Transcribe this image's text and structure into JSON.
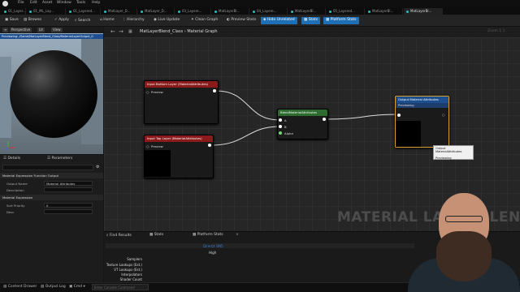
{
  "menu": [
    "File",
    "Edit",
    "Asset",
    "Window",
    "Tools",
    "Help"
  ],
  "tabs": [
    {
      "label": "01_Layer..."
    },
    {
      "label": "01_ML_Lay..."
    },
    {
      "label": "01_Layered..."
    },
    {
      "label": "MatLayer_D..."
    },
    {
      "label": "MatLayer_D..."
    },
    {
      "label": "03_Layere..."
    },
    {
      "label": "MatLayerBl..."
    },
    {
      "label": "04_Layere..."
    },
    {
      "label": "MatLayerBl..."
    },
    {
      "label": "05_Layered..."
    },
    {
      "label": "MatLayerBl..."
    },
    {
      "label": "MatLayerBl..."
    }
  ],
  "toolbar": {
    "save": "Save",
    "browse": "Browse",
    "apply": "Apply",
    "search": "Search",
    "home": "Home",
    "hierarchy": "Hierarchy",
    "live_update": "Live Update",
    "clean_graph": "Clean Graph",
    "preview_state": "Preview State",
    "hide_unrelated": "Hide Unrelated",
    "stats": "Stats",
    "platform_stats": "Platform Stats"
  },
  "viewport": {
    "perspective": "Perspective",
    "lit": "Lit",
    "view": "View",
    "status": "Previewing: /Game/MatLayerBlend_Class/MaterialLayerOutput_0"
  },
  "details": {
    "tab_details": "Details",
    "tab_parameters": "Parameters",
    "section_output": "Material Expression Function Output",
    "output_name_label": "Output Name",
    "output_name_value": "Material Attributes",
    "description_label": "Description",
    "section_expression": "Material Expression",
    "sort_priority_label": "Sort Priority",
    "sort_priority_value": "0",
    "desc_label": "Desc"
  },
  "graph": {
    "breadcrumb_root": "MatLayerBlend_Class",
    "breadcrumb_sep": "›",
    "breadcrumb_leaf": "Material Graph",
    "zoom": "Zoom 1:1",
    "watermark": "MATERIAL LAYER BLEND"
  },
  "nodes": {
    "input_bottom": {
      "title": "Input Bottom Layer (MaterialAttributes)",
      "pin": "Preview"
    },
    "input_top": {
      "title": "Input Top Layer (MaterialAttributes)",
      "pin": "Preview"
    },
    "blend": {
      "title": "BlendMaterialAttributes",
      "pin_a": "A",
      "pin_b": "B",
      "pin_alpha": "Alpha"
    },
    "output": {
      "title": "Output Material Attributes",
      "sub": "Previewing"
    }
  },
  "tooltip": {
    "line1": "Output MaterialAttributes",
    "line2": "Previewing"
  },
  "bottom": {
    "tab_find": "Find Results",
    "tab_stats": "Stats",
    "tab_platform": "Platform Stats",
    "platform_col": "DirectX SM5",
    "platform_sub": "High",
    "rows": [
      "Samplers",
      "Texture Lookups (Est.)",
      "VT Lookups (Est.)",
      "Interpolators",
      "Shader Count"
    ]
  },
  "statusbar": {
    "content_drawer": "Content Drawer",
    "output_log": "Output Log",
    "cmd": "Cmd",
    "cmd_placeholder": "Enter Console Command"
  },
  "colors": {
    "accent_blue": "#1f6fb5",
    "node_input_title": "#8b1a1a",
    "node_blend_title": "#2e6b2e",
    "node_output_title": "#1d4f8f",
    "output_border": "#d9a030"
  },
  "icons": [
    "save-icon",
    "browse-icon",
    "apply-icon",
    "search-icon",
    "home-icon",
    "back-icon",
    "forward-icon",
    "close-icon"
  ]
}
